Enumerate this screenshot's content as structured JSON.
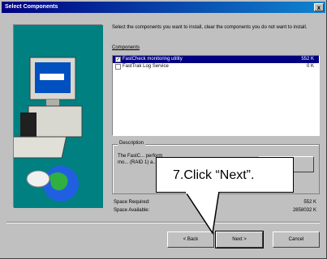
{
  "window": {
    "title": "Select Components",
    "close": "x"
  },
  "intro": "Select the components you want to install, clear the components you do not want to install.",
  "components_label": "Components",
  "components": [
    {
      "name": "FastCheck monitoring utility",
      "size": "552 K",
      "checked": true,
      "selected": true
    },
    {
      "name": "FastTrak Log Service",
      "size": "0 K",
      "checked": false,
      "selected": false
    }
  ],
  "description": {
    "legend": "Description",
    "text": "The FastC... perform mo... (RAID 1) a... array."
  },
  "space": {
    "required_label": "Space Required:",
    "required_value": "552 K",
    "available_label": "Space Available:",
    "available_value": "2858032 K"
  },
  "buttons": {
    "back": "< Back",
    "next": "Next >",
    "cancel": "Cancel"
  },
  "callout": "7.Click “Next”."
}
